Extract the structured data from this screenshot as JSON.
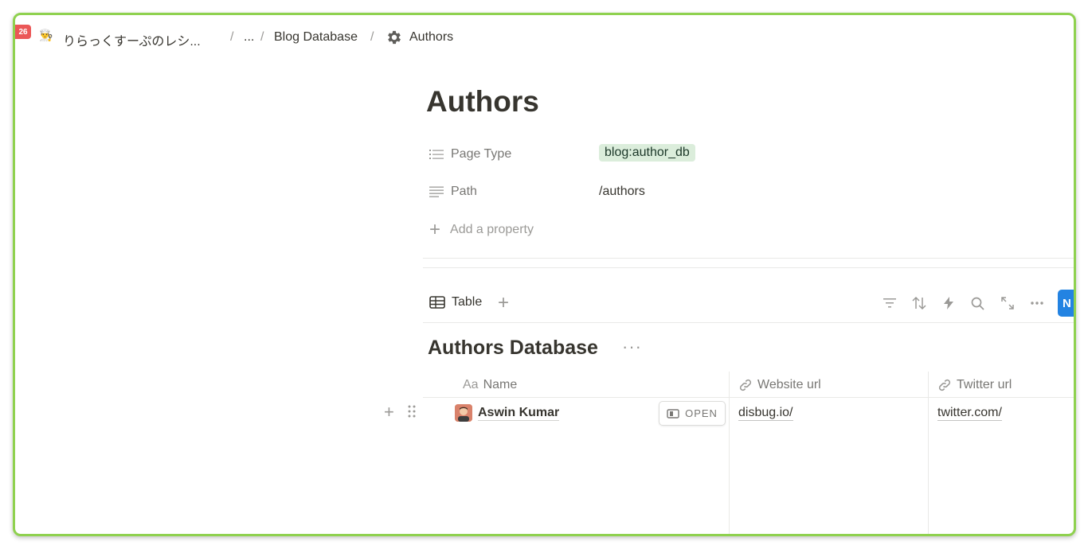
{
  "breadcrumb": {
    "badge": "26",
    "workspace_emoji": "👨‍🍳",
    "workspace": "りらっくすーぷのレシ...",
    "sep": "/",
    "ellipsis": "...",
    "parent": "Blog Database",
    "current": "Authors"
  },
  "page": {
    "title": "Authors",
    "properties": [
      {
        "icon": "list-icon",
        "label": "Page Type",
        "value": "blog:author_db",
        "value_kind": "tag",
        "tag_color": "#dbeddb"
      },
      {
        "icon": "text-lines-icon",
        "label": "Path",
        "value": "/authors"
      }
    ],
    "add_property": "Add a property"
  },
  "view": {
    "tab_label": "Table",
    "add_view": "+",
    "toolbar_icons": [
      "filter-icon",
      "sort-icon",
      "automation-icon",
      "search-icon",
      "expand-icon",
      "more-icon"
    ],
    "new_button": "N",
    "new_button_color": "#2383e2"
  },
  "database": {
    "title": "Authors Database",
    "more": "···",
    "columns": [
      {
        "icon": "Aa",
        "label": "Name"
      },
      {
        "icon": "link-icon",
        "label": "Website url"
      },
      {
        "icon": "link-icon",
        "label": "Twitter url"
      }
    ],
    "rows": [
      {
        "name": "Aswin Kumar",
        "open_label": "OPEN",
        "website": "disbug.io/",
        "twitter": "twitter.com/"
      }
    ],
    "row_add": "+"
  },
  "colors": {
    "frame_border": "#8fd14f",
    "badge": "#eb5757"
  }
}
